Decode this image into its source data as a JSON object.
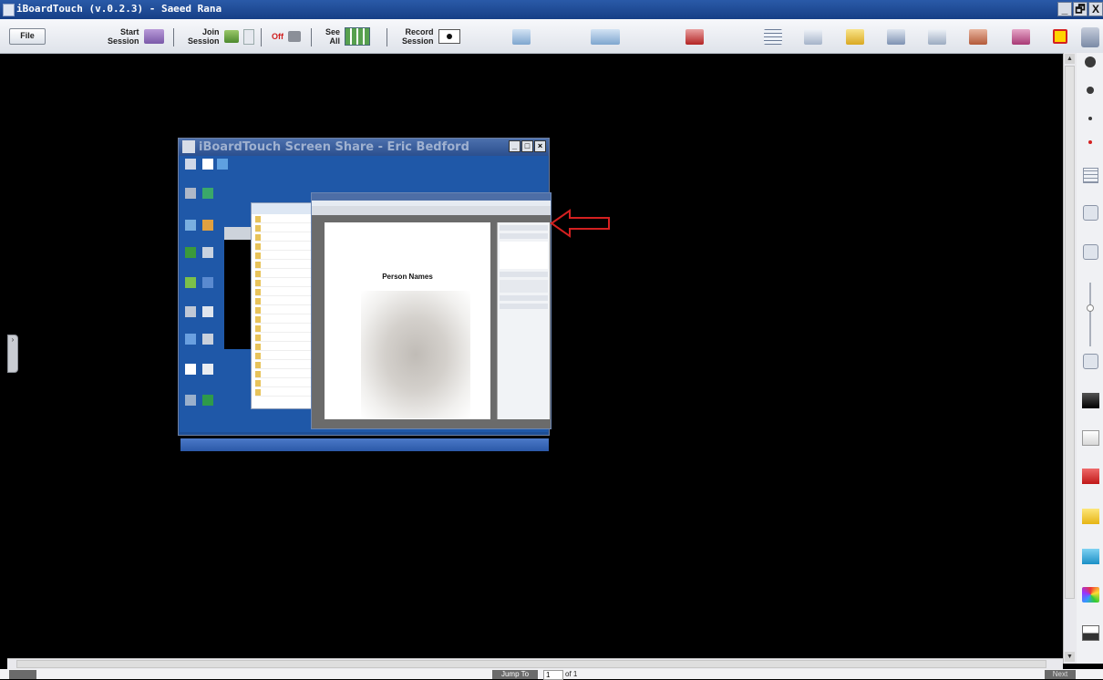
{
  "window": {
    "title": "iBoardTouch (v.0.2.3) - Saeed Rana",
    "buttons": [
      "_",
      "🗗",
      "X"
    ]
  },
  "toolbar": {
    "file_label": "File",
    "start_session_label_1": "Start",
    "start_session_label_2": "Session",
    "join_session_label_1": "Join",
    "join_session_label_2": "Session",
    "off_label": "Off",
    "see_all_label_1": "See",
    "see_all_label_2": "All",
    "record_session_label_1": "Record",
    "record_session_label_2": "Session"
  },
  "share_window": {
    "title": "iBoardTouch Screen Share - Eric Bedford",
    "pdf_heading": "Person Names"
  },
  "pagination": {
    "jump_label": "Jump To",
    "page_value": "1",
    "of_label": "of 1",
    "next_label": "Next"
  },
  "colors": {
    "accent_red": "#d42020",
    "title_blue": "#1d4a96"
  }
}
